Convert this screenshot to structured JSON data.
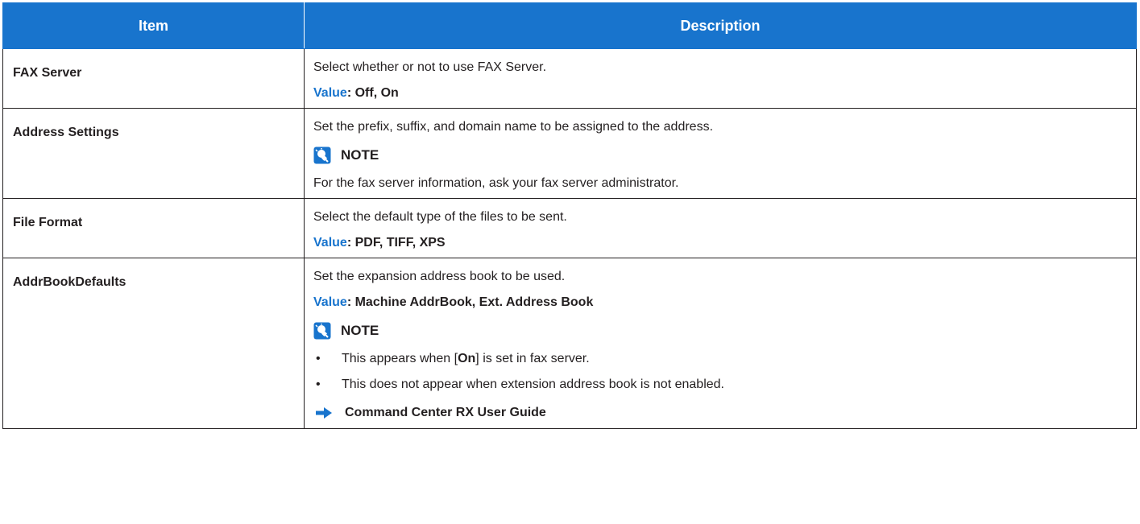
{
  "header": {
    "item": "Item",
    "description": "Description"
  },
  "rows": [
    {
      "item": "FAX Server",
      "desc": "Select whether or not to use FAX Server.",
      "value_label": "Value",
      "value_text": ": Off, On"
    },
    {
      "item": "Address Settings",
      "desc": "Set the prefix, suffix, and domain name to be assigned to the address.",
      "note_label": "NOTE",
      "note_text": "For the fax server information, ask your fax server administrator."
    },
    {
      "item": "File Format",
      "desc": "Select the default type of the files to be sent.",
      "value_label": "Value",
      "value_text": ": PDF, TIFF, XPS"
    },
    {
      "item": "AddrBookDefaults",
      "desc": "Set the expansion address book to be used.",
      "value_label": "Value",
      "value_text": ": Machine AddrBook, Ext. Address Book",
      "note_label": "NOTE",
      "bullet_1_pre": "This appears when [",
      "bullet_1_bold": "On",
      "bullet_1_post": "] is set in fax server.",
      "bullet_2": "This does not appear when extension address book is not enabled.",
      "bullet_symbol": "•",
      "reference": "Command Center RX User Guide"
    }
  ],
  "colors": {
    "accent": "#1874cd",
    "border": "#231f20",
    "text": "#231f20"
  },
  "icons": {
    "note": "note-lightbulb-icon",
    "reference": "arrow-right-icon"
  }
}
